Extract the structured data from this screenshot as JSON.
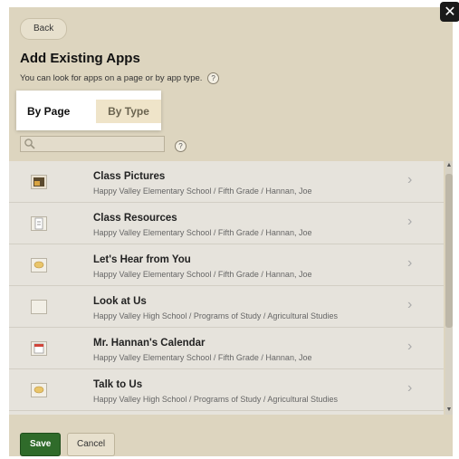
{
  "dialog": {
    "back_label": "Back",
    "title": "Add Existing Apps",
    "subtitle": "You can look for apps on a page or by app type.",
    "help_glyph": "?",
    "close_glyph": "✕"
  },
  "tabs": [
    {
      "label": "By Page",
      "active": true
    },
    {
      "label": "By Type",
      "active": false
    }
  ],
  "search": {
    "value": "",
    "placeholder": "",
    "help_glyph": "?"
  },
  "apps": [
    {
      "title": "Class Pictures",
      "path": "Happy Valley Elementary School / Fifth Grade / Hannan, Joe",
      "icon": "photo-icon"
    },
    {
      "title": "Class Resources",
      "path": "Happy Valley Elementary School / Fifth Grade / Hannan, Joe",
      "icon": "document-icon"
    },
    {
      "title": "Let's Hear from You",
      "path": "Happy Valley Elementary School / Fifth Grade / Hannan, Joe",
      "icon": "speech-bubble-icon"
    },
    {
      "title": "Look at Us",
      "path": "Happy Valley High School / Programs of Study / Agricultural Studies",
      "icon": "blank-icon"
    },
    {
      "title": "Mr. Hannan's Calendar",
      "path": "Happy Valley Elementary School / Fifth Grade / Hannan, Joe",
      "icon": "calendar-icon"
    },
    {
      "title": "Talk to Us",
      "path": "Happy Valley High School / Programs of Study / Agricultural Studies",
      "icon": "speech-bubble-icon"
    }
  ],
  "footer": {
    "save_label": "Save",
    "cancel_label": "Cancel"
  },
  "colors": {
    "save_green": "#2f6b2a",
    "panel_tan": "#ddd5bf",
    "list_bg": "#e6e3dc"
  }
}
